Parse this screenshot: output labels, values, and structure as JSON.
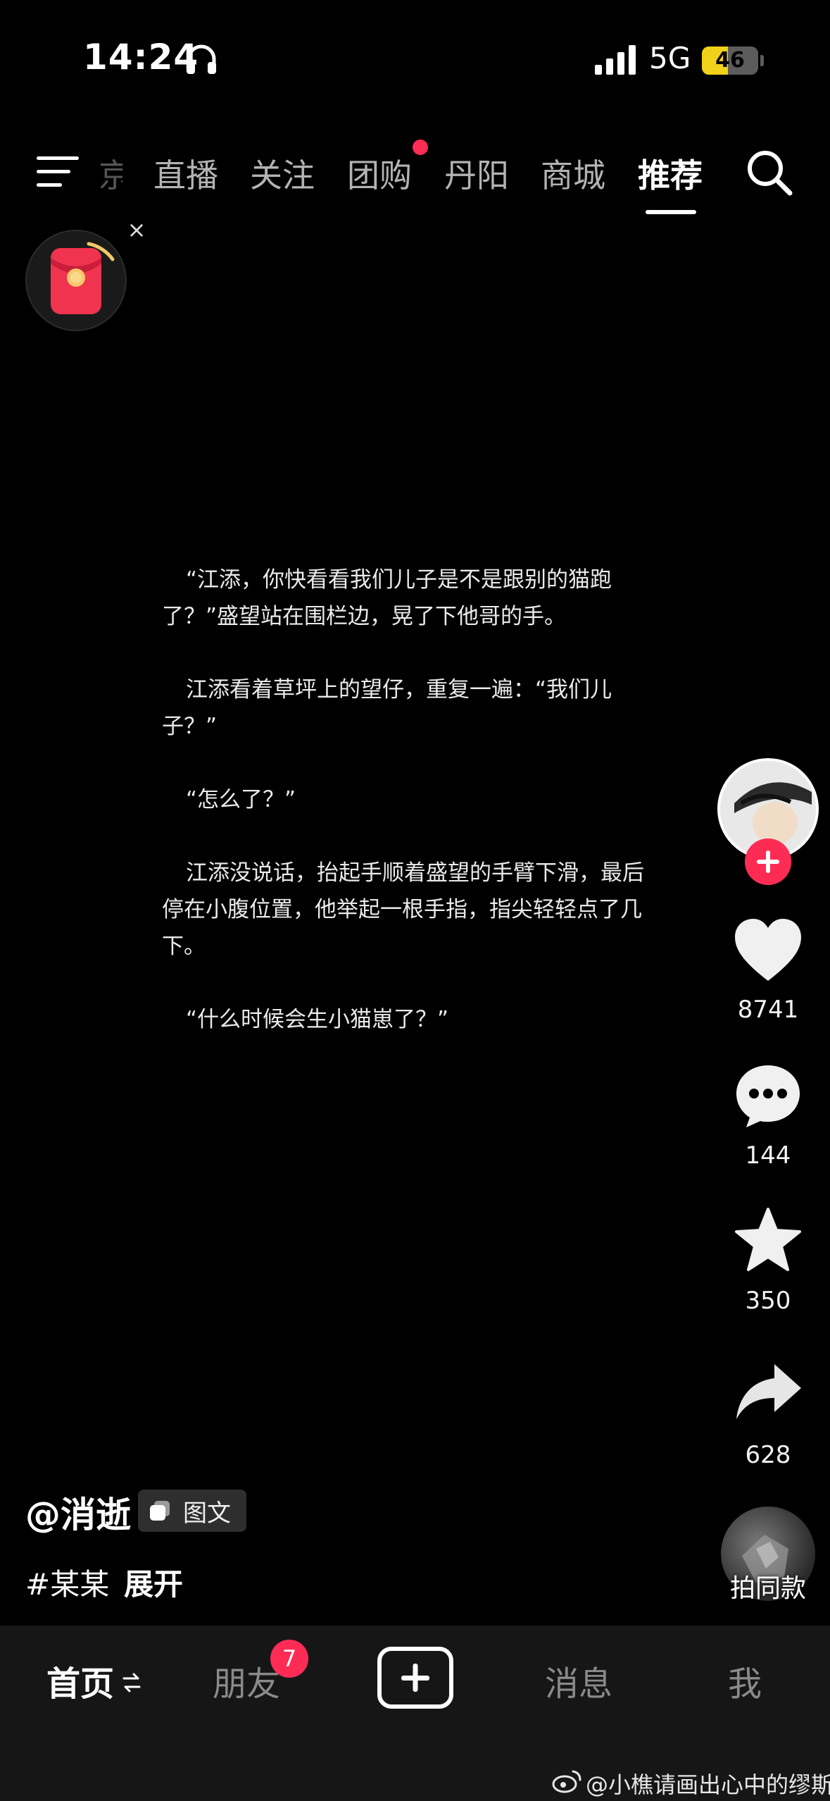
{
  "status_bar": {
    "time": "14:24",
    "network": "5G",
    "battery": 46,
    "battery_label": "46",
    "icons": [
      "headphone-icon",
      "signal-icon",
      "battery-icon"
    ]
  },
  "top_nav": {
    "tabs": [
      "直播",
      "关注",
      "团购",
      "丹阳",
      "商城",
      "推荐"
    ],
    "active_tab": "推荐",
    "cut_tab_fragment": "京",
    "colors": {
      "active": "#ffffff",
      "inactive": "#b3b3b3",
      "dot": "#fe2c55"
    }
  },
  "story": {
    "paragraphs": [
      "“江添，你快看看我们儿子是不是跟别的猫跑了？”盛望站在围栏边，晃了下他哥的手。",
      "江添看着草坪上的望仔，重复一遍：“我们儿子？”",
      "“怎么了？”",
      "江添没说话，抬起手顺着盛望的手臂下滑，最后停在小腹位置，他举起一根手指，指尖轻轻点了几下。",
      "“什么时候会生小猫崽了？”"
    ]
  },
  "actions": {
    "likes": "8741",
    "comments": "144",
    "favorites": "350",
    "shares": "628",
    "music_label": "拍同款",
    "accent": "#fe2c55"
  },
  "author": {
    "handle": "@消逝",
    "type_badge": "图文"
  },
  "caption": {
    "hashtag": "#某某",
    "expand": "展开"
  },
  "bottom_tabs": {
    "home": "首页",
    "friends": "朋友",
    "friends_badge": "7",
    "messages": "消息",
    "me": "我"
  },
  "watermark": "@小樵请画出心中的缪斯"
}
